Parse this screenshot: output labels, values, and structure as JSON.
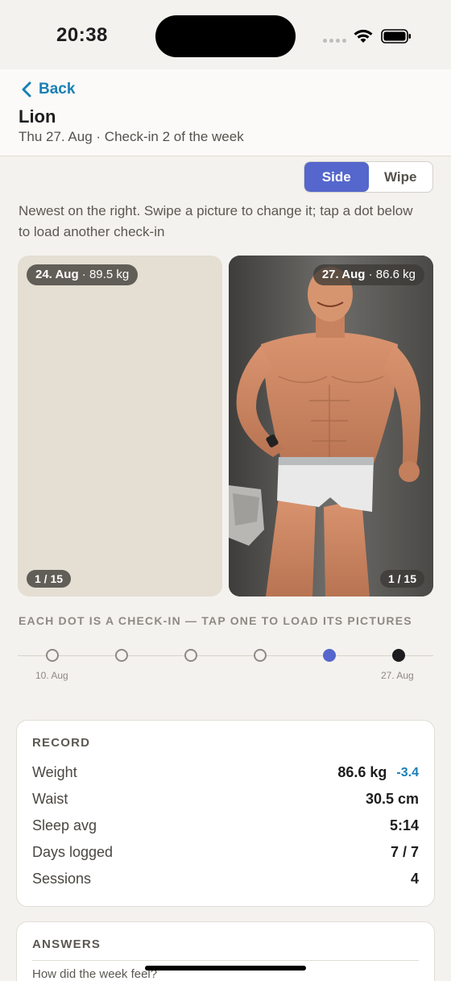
{
  "status_bar": {
    "time": "20:38"
  },
  "header": {
    "back_label": "Back",
    "title": "Lion",
    "subtitle": "Thu 27. Aug · Check-in 2 of the week"
  },
  "compare_mode": {
    "options": [
      "Side",
      "Wipe"
    ],
    "selected": "Side"
  },
  "hint": "Newest on the right. Swipe a picture to change it; tap a dot below to load another check-in",
  "photos": {
    "left": {
      "date": "24. Aug",
      "weight": "89.5 kg",
      "counter": "1 / 15"
    },
    "right": {
      "date": "27. Aug",
      "weight": "86.6 kg",
      "counter": "1 / 15"
    }
  },
  "timeline": {
    "caption": "EACH DOT IS A CHECK-IN — TAP ONE TO LOAD ITS PICTURES",
    "start_label": "10. Aug",
    "end_label": "27. Aug",
    "dot_count": 6,
    "selected_index": 4,
    "current_index": 5
  },
  "record": {
    "title": "RECORD",
    "rows": [
      {
        "label": "Weight",
        "value": "86.6 kg",
        "delta": "-3.4"
      },
      {
        "label": "Waist",
        "value": "30.5 cm"
      },
      {
        "label": "Sleep avg",
        "value": "5:14"
      },
      {
        "label": "Days logged",
        "value": "7 / 7"
      },
      {
        "label": "Sessions",
        "value": "4"
      }
    ]
  },
  "answers": {
    "title": "ANSWERS",
    "question": "How did the week feel?"
  },
  "colors": {
    "accent": "#5566cc",
    "link": "#1a7fb5",
    "background": "#f4f2ee"
  }
}
